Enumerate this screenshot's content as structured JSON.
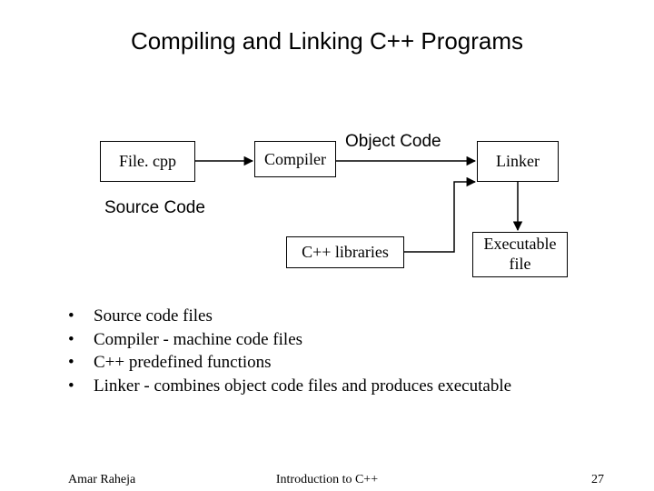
{
  "title": "Compiling and Linking C++ Programs",
  "boxes": {
    "file": "File. cpp",
    "compiler": "Compiler",
    "linker": "Linker",
    "libs": "C++ libraries",
    "exec_l1": "Executable",
    "exec_l2": "file"
  },
  "labels": {
    "object_code": "Object Code",
    "source_code": "Source Code"
  },
  "bullets": [
    "Source code files",
    "Compiler - machine code files",
    "C++ predefined functions",
    "Linker - combines object code files and produces executable"
  ],
  "footer": {
    "author": "Amar Raheja",
    "subject": "Introduction to C++",
    "page": "27"
  }
}
